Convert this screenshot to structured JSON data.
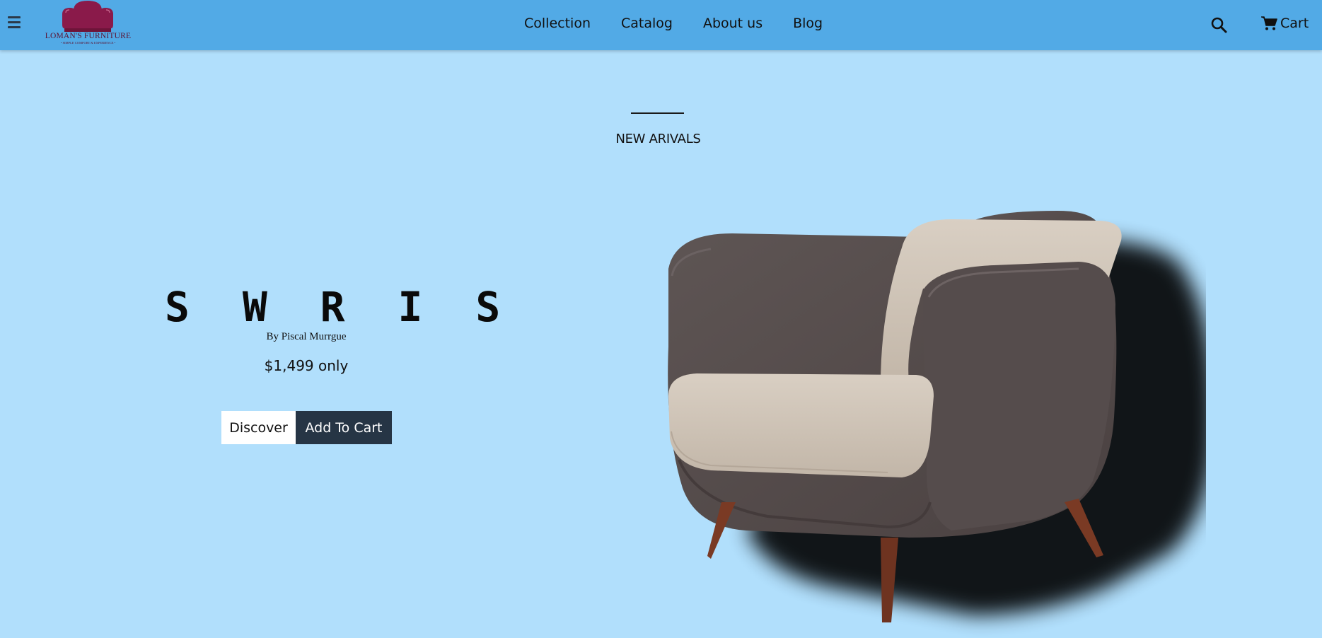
{
  "navbar": {
    "logo_text": "LOMAN'S FURNITURE",
    "logo_tagline": "• SIMPLE COMFORT & EXPERIENCE •",
    "links": [
      "Collection",
      "Catalog",
      "About us",
      "Blog"
    ],
    "cart_label": "Cart",
    "background_color": "#52aae6"
  },
  "section": {
    "title": "NEW ARIVALS"
  },
  "product": {
    "name": "S W R I S",
    "by": "By Piscal Murrgue",
    "price": "$1,499 only",
    "discover_label": "Discover",
    "add_to_cart_label": "Add To Cart"
  },
  "colors": {
    "page_background": "#b1dffc",
    "primary_button": "#263545",
    "logo_color": "#8a1a4a"
  },
  "icons": [
    "menu-icon",
    "armchair-logo-icon",
    "search-icon",
    "cart-icon"
  ]
}
